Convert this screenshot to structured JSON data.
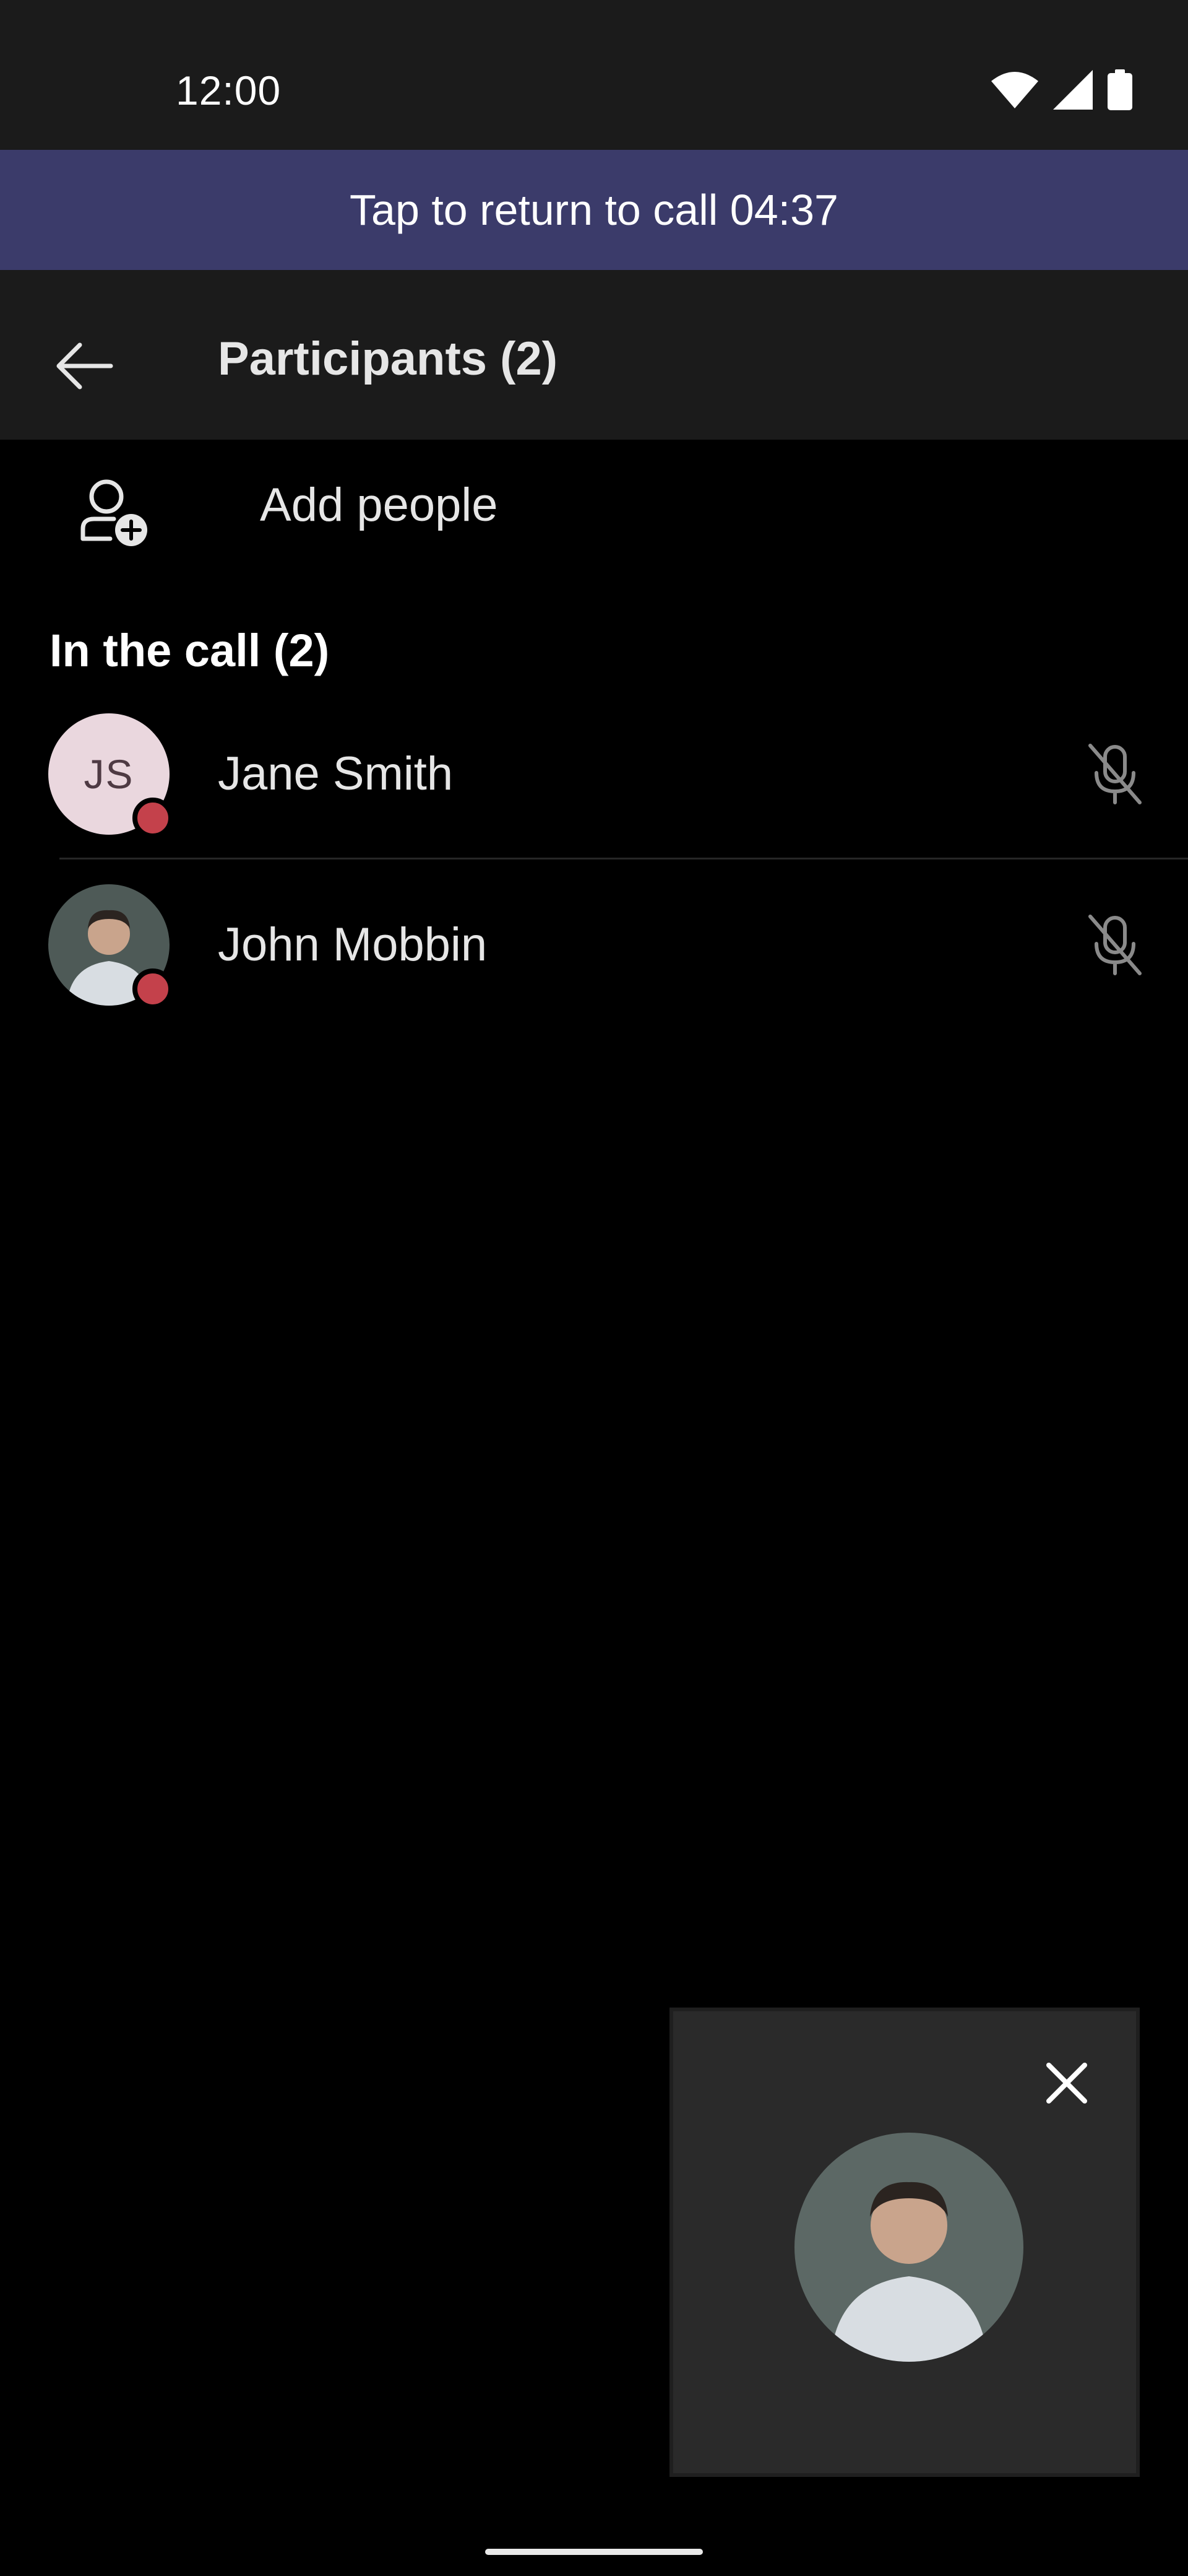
{
  "status_bar": {
    "time": "12:00",
    "icons": [
      "wifi-icon",
      "cellular-signal-icon",
      "battery-icon"
    ]
  },
  "call_banner": {
    "text": "Tap to return to call 04:37"
  },
  "app_bar": {
    "back_icon": "arrow-left-icon",
    "title": "Participants (2)"
  },
  "add_people": {
    "icon": "person-add-icon",
    "label": "Add people"
  },
  "section": {
    "title": "In the call (2)"
  },
  "participants": [
    {
      "name": "Jane Smith",
      "initials": "JS",
      "avatar": "initials",
      "presence_color": "#c4414b",
      "mic": "mic-off-icon"
    },
    {
      "name": "John Mobbin",
      "avatar": "photo",
      "presence_color": "#c4414b",
      "mic": "mic-off-icon"
    }
  ],
  "pip": {
    "close_icon": "close-icon",
    "avatar": "photo"
  },
  "colors": {
    "banner": "#3b3b6a",
    "app_bar": "#1b1b1b",
    "background": "#000000",
    "presence_busy": "#c4414b",
    "avatar_initials_bg": "#ead7de"
  }
}
